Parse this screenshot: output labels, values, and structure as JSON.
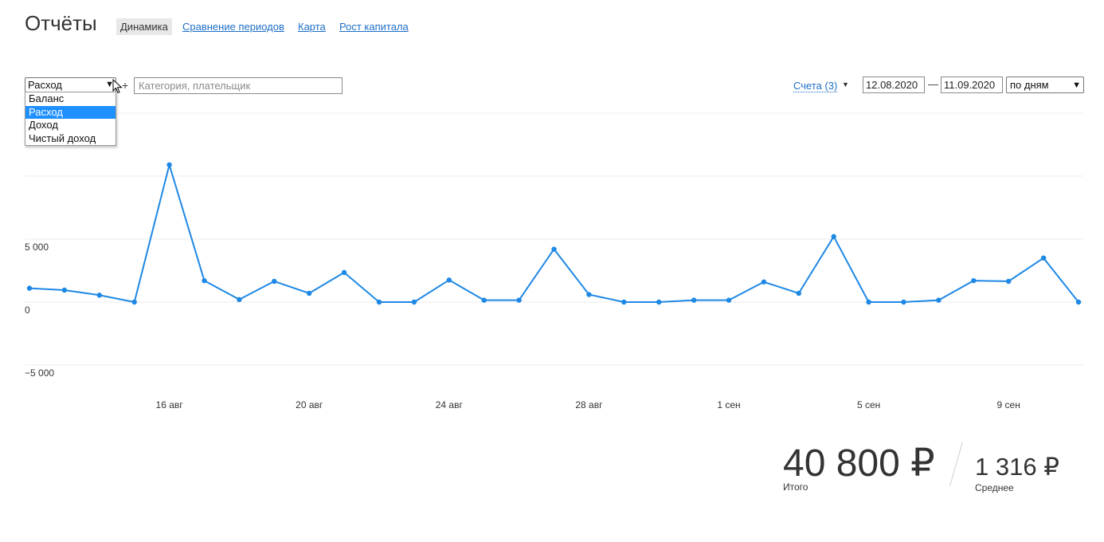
{
  "header": {
    "title": "Отчёты",
    "tabs": [
      {
        "label": "Динамика",
        "active": true
      },
      {
        "label": "Сравнение периодов",
        "active": false
      },
      {
        "label": "Карта",
        "active": false
      },
      {
        "label": "Рост капитала",
        "active": false
      }
    ]
  },
  "filters": {
    "type_select": {
      "value": "Расход",
      "options": [
        "Баланс",
        "Расход",
        "Доход",
        "Чистый доход"
      ],
      "highlighted": "Расход",
      "open": true
    },
    "add_symbol": "+",
    "category_placeholder": "Категория, плательщик",
    "accounts_label": "Счета (3)",
    "date_from": "12.08.2020",
    "date_separator": "—",
    "date_to": "11.09.2020",
    "grouping": "по дням"
  },
  "chart_data": {
    "type": "line",
    "series": [
      {
        "values": [
          1100,
          950,
          550,
          0,
          10900,
          1700,
          200,
          1650,
          700,
          2350,
          0,
          0,
          1750,
          150,
          150,
          4200,
          600,
          0,
          0,
          150,
          150,
          1600,
          700,
          5200,
          0,
          0,
          150,
          1700,
          1650,
          3500,
          0
        ]
      }
    ],
    "x": [
      "12.08",
      "13.08",
      "14.08",
      "15.08",
      "16.08",
      "17.08",
      "18.08",
      "19.08",
      "20.08",
      "21.08",
      "22.08",
      "23.08",
      "24.08",
      "25.08",
      "26.08",
      "27.08",
      "28.08",
      "29.08",
      "30.08",
      "31.08",
      "01.09",
      "02.09",
      "03.09",
      "04.09",
      "05.09",
      "06.09",
      "07.09",
      "08.09",
      "09.09",
      "10.09",
      "11.09"
    ],
    "x_tick_labels": [
      {
        "index": 4,
        "label": "16 авг"
      },
      {
        "index": 8,
        "label": "20 авг"
      },
      {
        "index": 12,
        "label": "24 авг"
      },
      {
        "index": 16,
        "label": "28 авг"
      },
      {
        "index": 20,
        "label": "1 сен"
      },
      {
        "index": 24,
        "label": "5 сен"
      },
      {
        "index": 28,
        "label": "9 сен"
      }
    ],
    "y_ticks": [
      {
        "value": 5000,
        "label": "5 000"
      },
      {
        "value": 0,
        "label": "0"
      },
      {
        "value": -5000,
        "label": "−5 000"
      }
    ],
    "ylim": [
      -5000,
      15000
    ],
    "grid": true,
    "line_color": "#1e88e5"
  },
  "summary": {
    "total_value": "40 800 ₽",
    "total_label": "Итого",
    "average_value": "1 316 ₽",
    "average_label": "Среднее"
  }
}
